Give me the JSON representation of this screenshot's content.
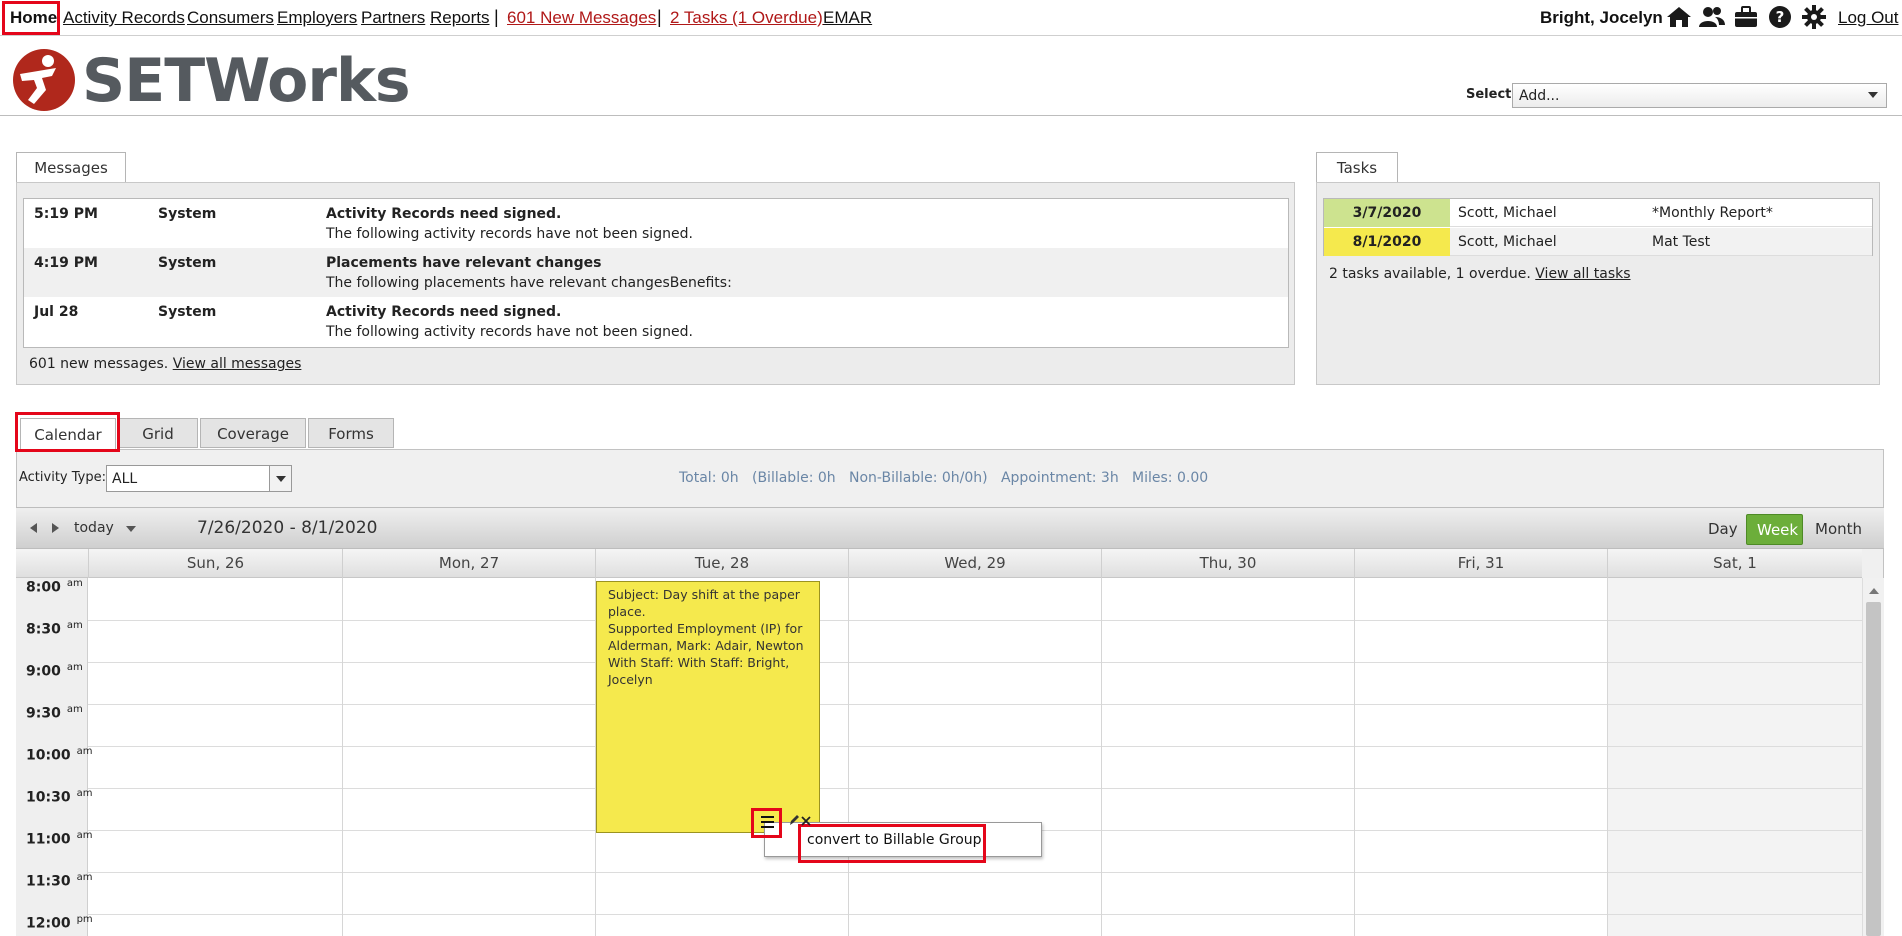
{
  "nav": {
    "home": "Home",
    "activity_records": "Activity Records",
    "consumers": "Consumers",
    "employers": "Employers",
    "partners": "Partners",
    "reports": "Reports",
    "sep": "|",
    "new_messages": "601 New Messages",
    "tasks": "2 Tasks (1 Overdue)",
    "emar": "EMAR",
    "user_name": "Bright, Jocelyn",
    "logout": "Log Out",
    "icons": [
      "home-icon",
      "users-icon",
      "briefcase-icon",
      "help-icon",
      "gear-icon"
    ]
  },
  "header": {
    "logo_text": "SETWorks",
    "select_label": "Select:",
    "select_value": "Add...",
    "brand_color": "#b0281c"
  },
  "messages": {
    "tab": "Messages",
    "items": [
      {
        "time": "5:19 PM",
        "from": "System",
        "subject": "Activity Records need signed.",
        "body": "The following activity records have not been signed."
      },
      {
        "time": "4:19 PM",
        "from": "System",
        "subject": "Placements have relevant changes",
        "body": "The following placements have relevant changesBenefits:"
      },
      {
        "time": "Jul 28",
        "from": "System",
        "subject": "Activity Records need signed.",
        "body": "The following activity records have not been signed."
      }
    ],
    "footer_text": "601 new messages.",
    "footer_link": "View all messages"
  },
  "tasks": {
    "tab": "Tasks",
    "items": [
      {
        "date": "3/7/2020",
        "name": "Scott, Michael",
        "title": "*Monthly Report*",
        "color": "#cde38f"
      },
      {
        "date": "8/1/2020",
        "name": "Scott, Michael",
        "title": "Mat Test",
        "color": "#f5e94d"
      }
    ],
    "footer_text": "2 tasks available, 1 overdue.",
    "footer_link": "View all tasks"
  },
  "view_tabs": [
    "Calendar",
    "Grid",
    "Coverage",
    "Forms"
  ],
  "filters": {
    "activity_type_label": "Activity Type:",
    "activity_type_value": "ALL",
    "summary": "Total: 0h   (Billable: 0h   Non-Billable: 0h/0h)   Appointment: 3h   Miles: 0.00"
  },
  "calendar": {
    "today_label": "today",
    "range": "7/26/2020 - 8/1/2020",
    "views": [
      "Day",
      "Week",
      "Month"
    ],
    "active_view": "Week",
    "active_color": "#6cae3a",
    "days": [
      "Sun, 26",
      "Mon, 27",
      "Tue, 28",
      "Wed, 29",
      "Thu, 30",
      "Fri, 31",
      "Sat, 1"
    ],
    "times": [
      {
        "t": "8:00",
        "p": "am"
      },
      {
        "t": "8:30",
        "p": "am"
      },
      {
        "t": "9:00",
        "p": "am"
      },
      {
        "t": "9:30",
        "p": "am"
      },
      {
        "t": "10:00",
        "p": "am"
      },
      {
        "t": "10:30",
        "p": "am"
      },
      {
        "t": "11:00",
        "p": "am"
      },
      {
        "t": "11:30",
        "p": "am"
      },
      {
        "t": "12:00",
        "p": "pm"
      }
    ],
    "event": {
      "line1": "Subject: Day shift at the paper place.",
      "line2": "Supported Employment (IP) for Alderman, Mark: Adair, Newton",
      "line3": "With Staff: With Staff: Bright, Jocelyn"
    },
    "popup_item": "convert to Billable Group"
  }
}
